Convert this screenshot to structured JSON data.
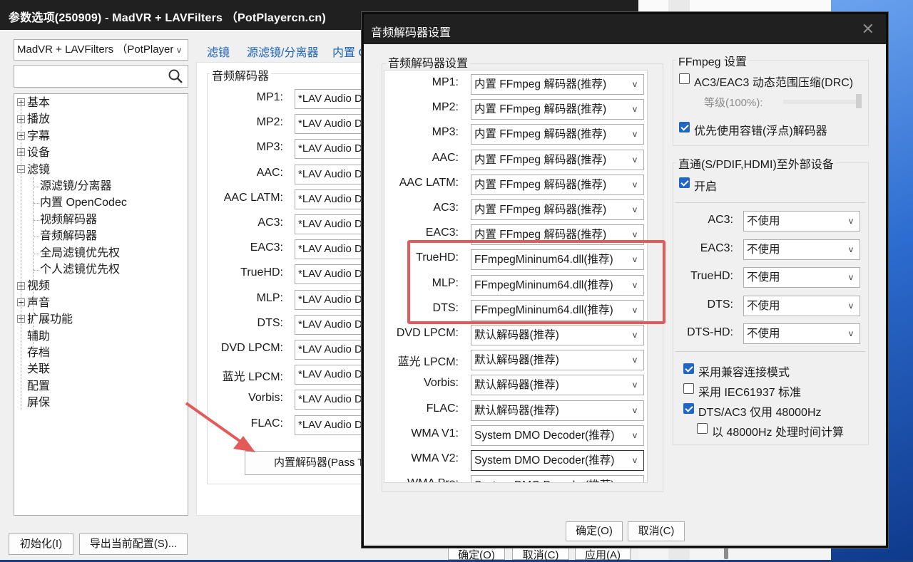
{
  "main_window": {
    "title": "参数选项(250909) - MadVR + LAVFilters （PotPlayercn.cn)",
    "controls": "ｖ ✕",
    "profile_select": "MadVR + LAVFilters （PotPlayer",
    "tree": {
      "items": [
        {
          "label": "基本",
          "expander": "plus"
        },
        {
          "label": "播放",
          "expander": "plus"
        },
        {
          "label": "字幕",
          "expander": "plus"
        },
        {
          "label": "设备",
          "expander": "plus"
        },
        {
          "label": "滤镜",
          "expander": "minus"
        },
        {
          "label": "源滤镜/分离器",
          "child": true
        },
        {
          "label": "内置 OpenCodec",
          "child": true
        },
        {
          "label": "视频解码器",
          "child": true
        },
        {
          "label": "音频解码器",
          "child": true
        },
        {
          "label": "全局滤镜优先权",
          "child": true
        },
        {
          "label": "个人滤镜优先权",
          "child": true
        },
        {
          "label": "视频",
          "expander": "plus"
        },
        {
          "label": "声音",
          "expander": "plus"
        },
        {
          "label": "扩展功能",
          "expander": "plus"
        },
        {
          "label": "辅助"
        },
        {
          "label": "存档"
        },
        {
          "label": "关联"
        },
        {
          "label": "配置"
        },
        {
          "label": "屏保"
        }
      ]
    },
    "tabs": [
      "滤镜",
      "源滤镜/分离器",
      "内置 O"
    ],
    "panel": {
      "group_title": "音频解码器",
      "rows": [
        {
          "label": "MP1:",
          "value": "*LAV Audio D"
        },
        {
          "label": "MP2:",
          "value": "*LAV Audio D"
        },
        {
          "label": "MP3:",
          "value": "*LAV Audio D"
        },
        {
          "label": "AAC:",
          "value": "*LAV Audio D"
        },
        {
          "label": "AAC LATM:",
          "value": "*LAV Audio D"
        },
        {
          "label": "AC3:",
          "value": "*LAV Audio D"
        },
        {
          "label": "EAC3:",
          "value": "*LAV Audio D"
        },
        {
          "label": "TrueHD:",
          "value": "*LAV Audio D"
        },
        {
          "label": "MLP:",
          "value": "*LAV Audio D"
        },
        {
          "label": "DTS:",
          "value": "*LAV Audio D"
        },
        {
          "label": "DVD LPCM:",
          "value": "*LAV Audio D"
        },
        {
          "label": "蓝光 LPCM:",
          "value": "*LAV Audio D"
        },
        {
          "label": "Vorbis:",
          "value": "*LAV Audio D"
        },
        {
          "label": "FLAC:",
          "value": "*LAV Audio D"
        }
      ],
      "builtin_button": "内置解码器(Pass T"
    },
    "footer": {
      "reset": "初始化(I)",
      "export": "导出当前配置(S)...",
      "hidden_buttons": [
        "确定(O)",
        "取消(C)",
        "应用(A)"
      ]
    }
  },
  "dialog": {
    "title": "音频解码器设置",
    "close": "✕",
    "list_title": "音频解码器设置",
    "decoders": [
      {
        "label": "MP1:",
        "value": "内置 FFmpeg 解码器(推荐)"
      },
      {
        "label": "MP2:",
        "value": "内置 FFmpeg 解码器(推荐)"
      },
      {
        "label": "MP3:",
        "value": "内置 FFmpeg 解码器(推荐)"
      },
      {
        "label": "AAC:",
        "value": "内置 FFmpeg 解码器(推荐)"
      },
      {
        "label": "AAC LATM:",
        "value": "内置 FFmpeg 解码器(推荐)"
      },
      {
        "label": "AC3:",
        "value": "内置 FFmpeg 解码器(推荐)"
      },
      {
        "label": "EAC3:",
        "value": "内置 FFmpeg 解码器(推荐)"
      },
      {
        "label": "TrueHD:",
        "value": "FFmpegMininum64.dll(推荐)"
      },
      {
        "label": "MLP:",
        "value": "FFmpegMininum64.dll(推荐)"
      },
      {
        "label": "DTS:",
        "value": "FFmpegMininum64.dll(推荐)"
      },
      {
        "label": "DVD LPCM:",
        "value": "默认解码器(推荐)"
      },
      {
        "label": "蓝光 LPCM:",
        "value": "默认解码器(推荐)"
      },
      {
        "label": "Vorbis:",
        "value": "默认解码器(推荐)"
      },
      {
        "label": "FLAC:",
        "value": "默认解码器(推荐)"
      },
      {
        "label": "WMA V1:",
        "value": "System DMO Decoder(推荐)"
      },
      {
        "label": "WMA V2:",
        "value": "System DMO Decoder(推荐)"
      },
      {
        "label": "WMA Pro:",
        "value": "System DMO Decoder(推荐)"
      }
    ],
    "ffmpeg": {
      "title": "FFmpeg 设置",
      "drc_label": "AC3/EAC3 动态范围压缩(DRC)",
      "drc_checked": false,
      "level_label": "等级(100%):",
      "level_value": 1.0,
      "float_label": "优先使用容错(浮点)解码器",
      "float_checked": true
    },
    "passthrough": {
      "title": "直通(S/PDIF,HDMI)至外部设备",
      "enable_label": "开启",
      "enable_checked": true,
      "formats": [
        {
          "label": "AC3:",
          "value": "不使用"
        },
        {
          "label": "EAC3:",
          "value": "不使用"
        },
        {
          "label": "TrueHD:",
          "value": "不使用"
        },
        {
          "label": "DTS:",
          "value": "不使用"
        },
        {
          "label": "DTS-HD:",
          "value": "不使用"
        }
      ],
      "options": [
        {
          "label": "采用兼容连接模式",
          "checked": true
        },
        {
          "label": "采用 IEC61937 标准",
          "checked": false
        },
        {
          "label": "DTS/AC3 仅用 48000Hz",
          "checked": true
        },
        {
          "label": "以 48000Hz 处理时间计算",
          "checked": false
        }
      ]
    },
    "ok": "确定(O)",
    "cancel": "取消(C)"
  },
  "colors": {
    "titlebar": "#202020",
    "accent": "#1f66c5",
    "link": "#1a62b8",
    "highlight": "#e35a5a"
  }
}
